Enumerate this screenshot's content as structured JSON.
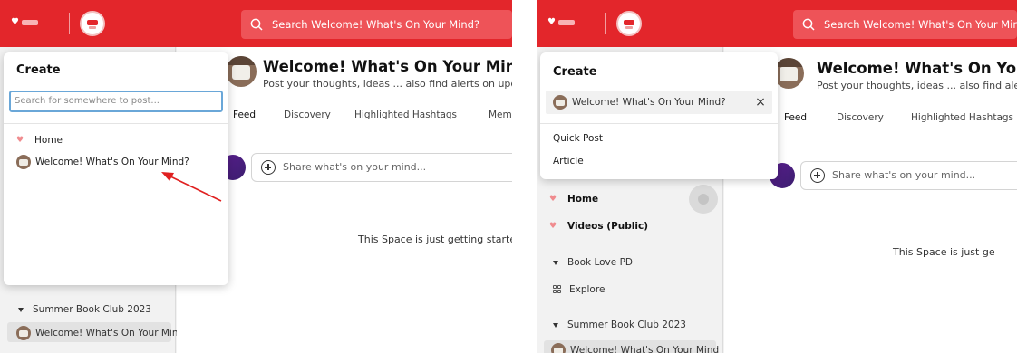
{
  "colors": {
    "brand": "#e3262b",
    "search_bg": "#ee5358",
    "focus_border": "#6aa7d8",
    "arrow": "#e02020"
  },
  "left": {
    "search": {
      "placeholder": "Search Welcome! What's On Your Mind?"
    },
    "space": {
      "title": "Welcome! What's On Your Mind?",
      "subtitle": "Post your thoughts, ideas ... also find alerts on upcomin"
    },
    "tabs": [
      "Feed",
      "Discovery",
      "Highlighted Hashtags",
      "Member"
    ],
    "share_placeholder": "Share what's on your mind...",
    "empty_message": "This Space is just getting started!",
    "sidebar": {
      "group": "Summer Book Club 2023",
      "selected_space": "Welcome! What's On Your Mind"
    },
    "popup": {
      "title": "Create",
      "search_placeholder": "Search for somewhere to post...",
      "items": [
        "Home",
        "Welcome! What's On Your Mind?"
      ]
    }
  },
  "right": {
    "search": {
      "placeholder": "Search Welcome! What's On Your Mind"
    },
    "space": {
      "title": "Welcome! What's On Your M",
      "subtitle": "Post your thoughts, ideas ... also find alert"
    },
    "tabs": [
      "Feed",
      "Discovery",
      "Highlighted Hashtags"
    ],
    "share_placeholder": "Share what's on your mind...",
    "empty_message": "This Space is just ge",
    "sidebar": {
      "items": [
        "Home",
        "Videos (Public)"
      ],
      "group1": "Book Love PD",
      "explore": "Explore",
      "group2": "Summer Book Club 2023",
      "selected_space": "Welcome! What's On Your Mind"
    },
    "popup": {
      "title": "Create",
      "selected": "Welcome! What's On Your Mind?",
      "options": [
        "Quick Post",
        "Article"
      ]
    }
  }
}
